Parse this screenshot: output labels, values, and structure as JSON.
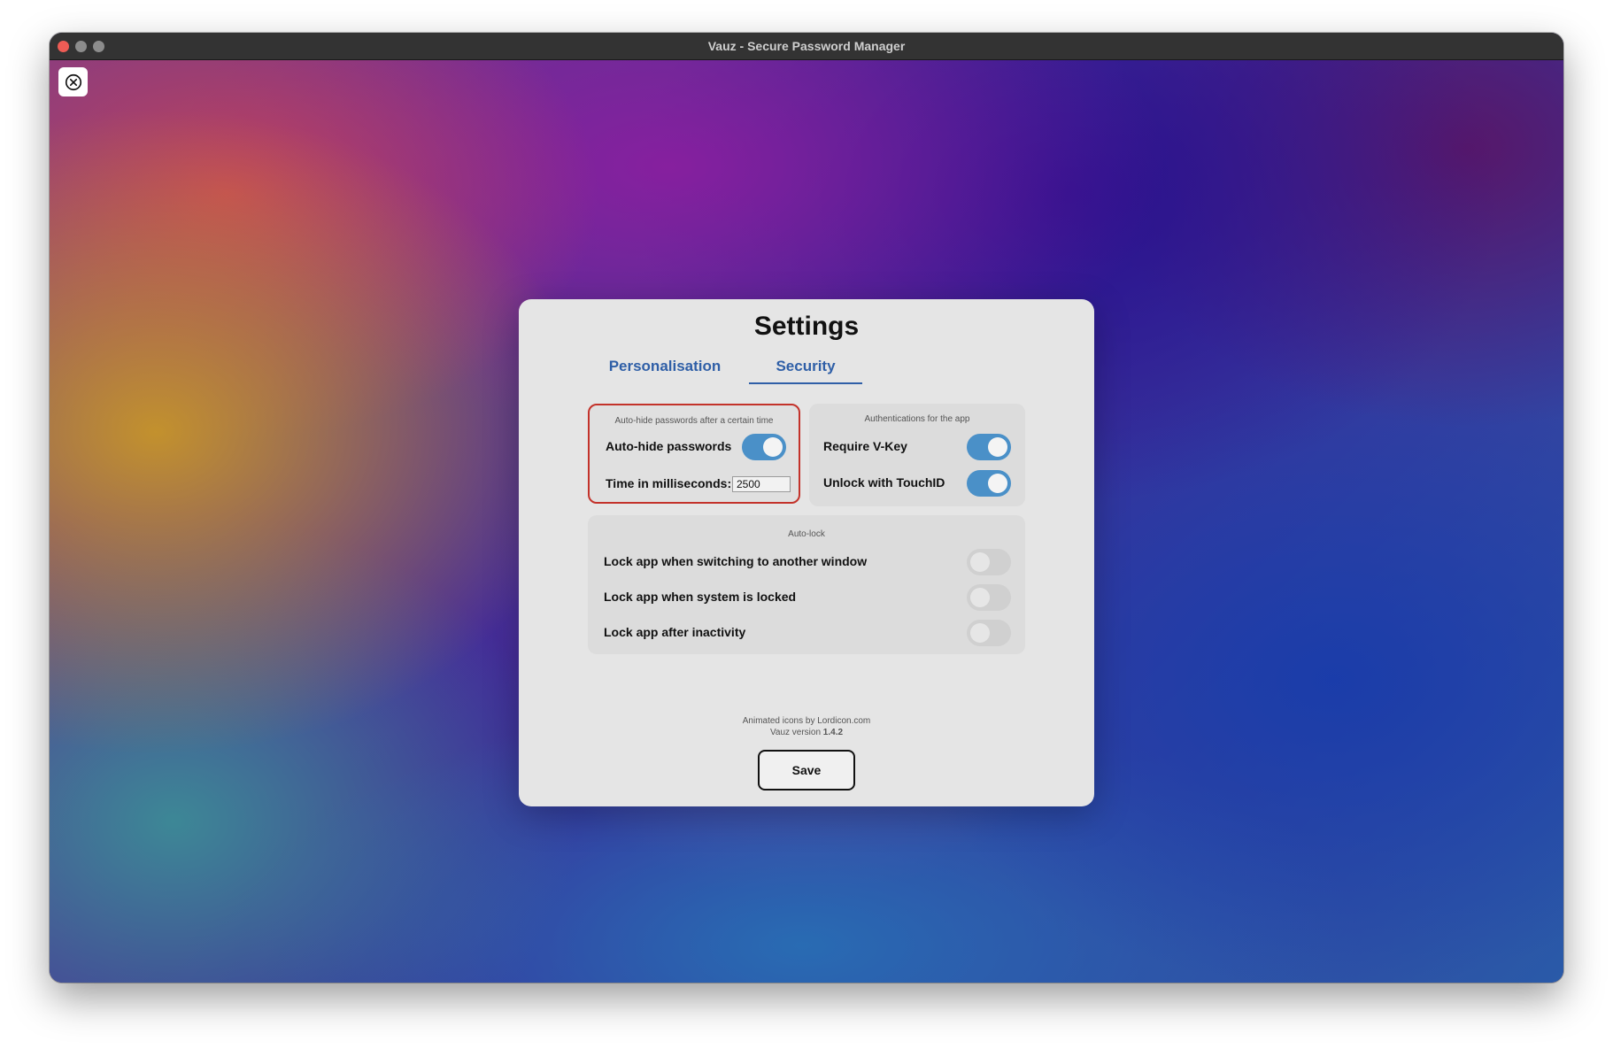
{
  "window": {
    "title": "Vauz - Secure Password Manager"
  },
  "settings": {
    "heading": "Settings",
    "tabs": [
      {
        "label": "Personalisation",
        "active": false
      },
      {
        "label": "Security",
        "active": true
      }
    ],
    "autohide_panel": {
      "caption": "Auto-hide passwords after a certain time",
      "autohide_label": "Auto-hide passwords",
      "autohide_on": true,
      "time_label": "Time in milliseconds:",
      "time_value": "2500"
    },
    "auth_panel": {
      "caption": "Authentications for the app",
      "vkey_label": "Require V-Key",
      "vkey_on": true,
      "touchid_label": "Unlock with TouchID",
      "touchid_on": true
    },
    "autolock_panel": {
      "caption": "Auto-lock",
      "items": [
        {
          "label": "Lock app when switching to another window",
          "on": false
        },
        {
          "label": "Lock app when system is locked",
          "on": false
        },
        {
          "label": "Lock app after inactivity",
          "on": false
        }
      ]
    },
    "footer": {
      "credits": "Animated icons by Lordicon.com",
      "version_prefix": "Vauz version ",
      "version": "1.4.2"
    },
    "save_label": "Save"
  },
  "colors": {
    "accent": "#4a90c8",
    "tab_text": "#2f5fa7",
    "highlight_border": "#c3322a",
    "card_bg": "#e5e5e5"
  }
}
